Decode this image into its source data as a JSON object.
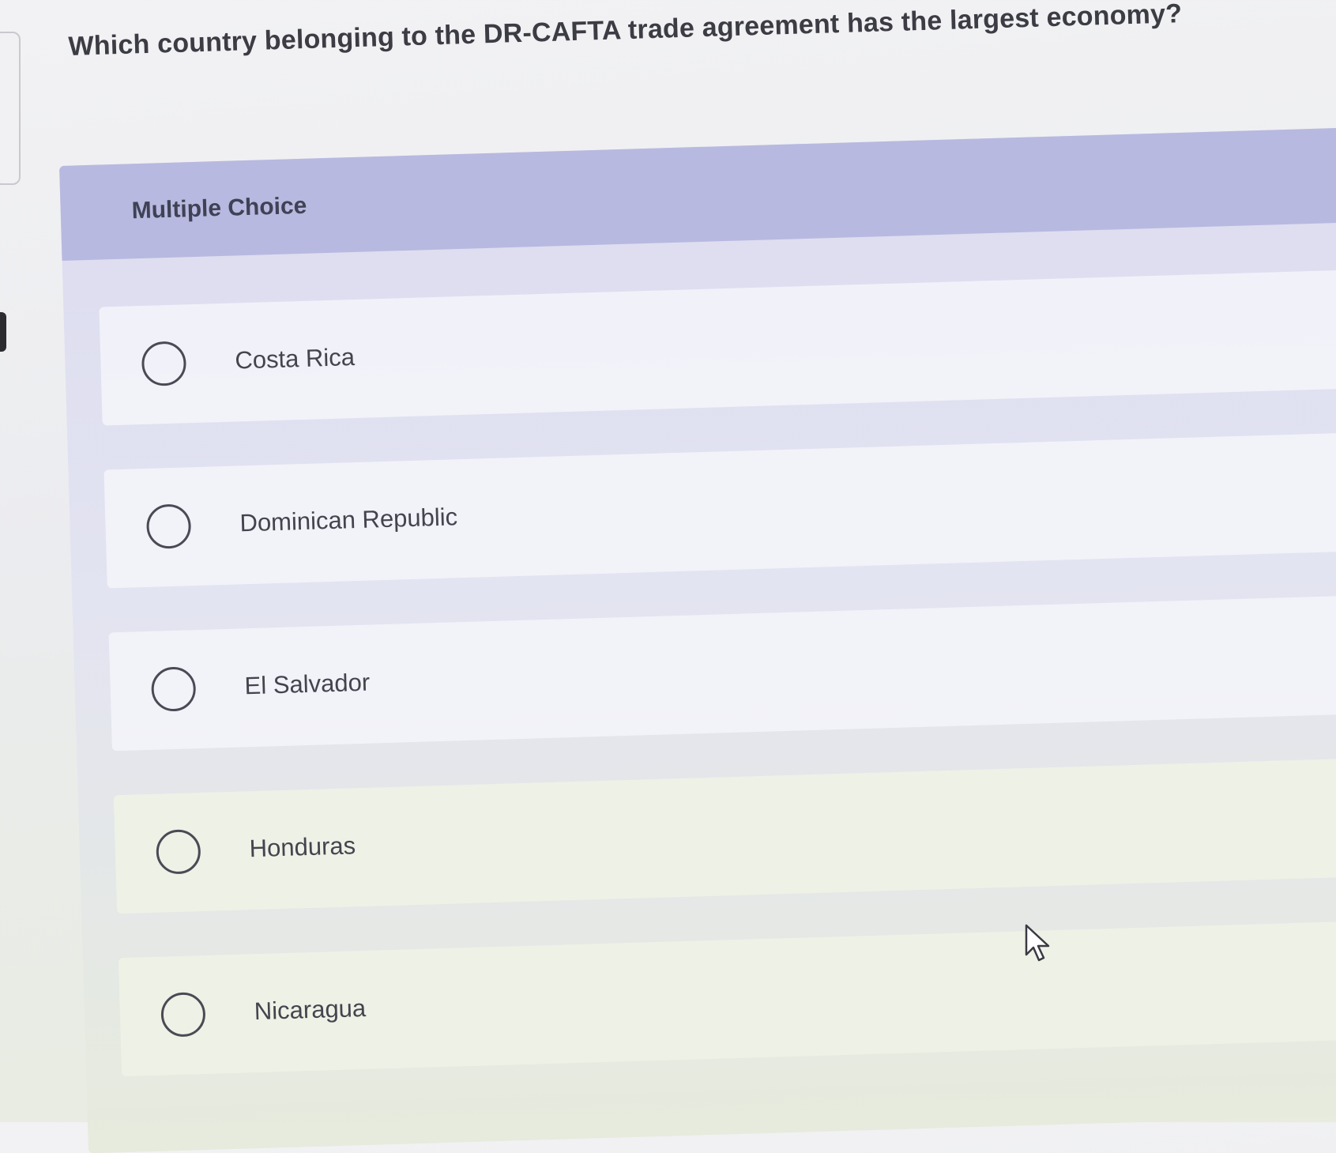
{
  "question": {
    "text": "Which country belonging to the DR-CAFTA trade agreement has the largest economy?"
  },
  "panel": {
    "label": "Multiple Choice"
  },
  "options": [
    {
      "label": "Costa Rica"
    },
    {
      "label": "Dominican Republic"
    },
    {
      "label": "El Salvador"
    },
    {
      "label": "Honduras"
    },
    {
      "label": "Nicaragua"
    }
  ],
  "icons": {
    "radio": "radio-unselected-icon",
    "cursor": "mouse-pointer-icon"
  }
}
